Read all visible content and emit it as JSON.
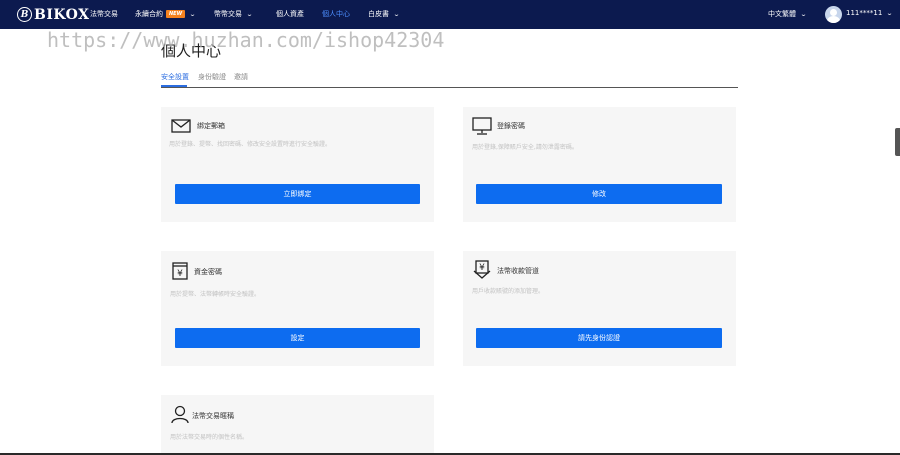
{
  "brand": {
    "name": "BIKOX",
    "badge": "B"
  },
  "nav": {
    "items": [
      {
        "label": "法幣交易"
      },
      {
        "label": "永續合約",
        "badge": "NEW"
      },
      {
        "label": "幣幣交易"
      },
      {
        "label": "個人資產"
      },
      {
        "label": "個人中心"
      },
      {
        "label": "白皮書"
      }
    ],
    "language": "中文繁體",
    "username": "111****11",
    "caret": "⌄"
  },
  "watermark": "https://www.huzhan.com/ishop42304",
  "page": {
    "title": "個人中心",
    "tabs": [
      "安全設置",
      "身份驗證",
      "邀請"
    ]
  },
  "cards": [
    {
      "icon": "envelope-icon",
      "title": "綁定郵箱",
      "desc": "用於登錄、提幣、找回密碼、修改安全設置時進行安全驗證。",
      "button": "立即綁定"
    },
    {
      "icon": "monitor-icon",
      "title": "登錄密碼",
      "desc": "用於登錄,保障賬戶安全,請勿泄露密碼。",
      "button": "修改"
    },
    {
      "icon": "yen-lock-icon",
      "title": "資金密碼",
      "desc": "用於提幣、法幣轉帳時安全驗證。",
      "button": "設定"
    },
    {
      "icon": "yen-down-icon",
      "title": "法幣收款管道",
      "desc": "用戶收款賬號的添加管理。",
      "button": "請先身份認證"
    },
    {
      "icon": "person-icon",
      "title": "法幣交易暱稱",
      "desc": "用於法幣交易時的個性名稱。"
    }
  ],
  "colors": {
    "nav_bg": "#0c1a4f",
    "accent": "#0d6cf0",
    "card_bg": "#f6f6f6",
    "active_tab": "#2b6de0"
  }
}
